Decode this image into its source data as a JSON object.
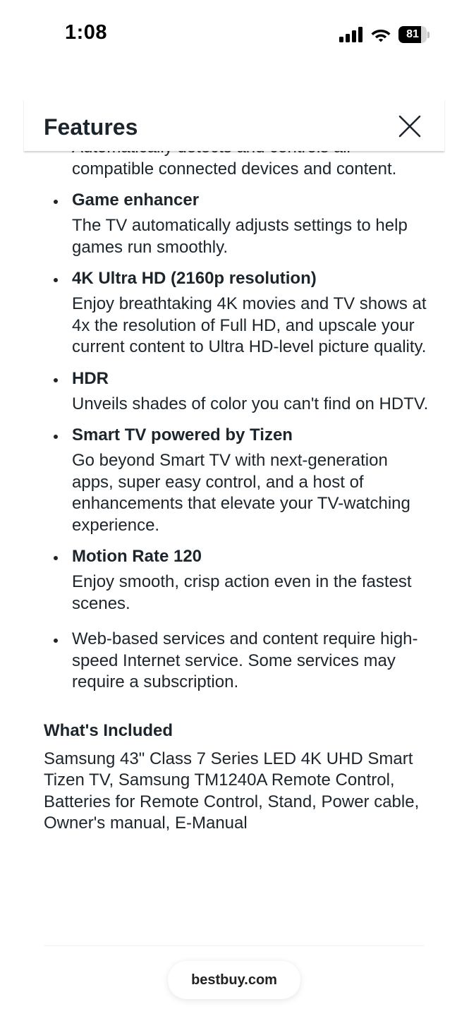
{
  "status_bar": {
    "time": "1:08",
    "battery_level": 81,
    "battery_text": "81",
    "icons": [
      "cellular-signal-icon",
      "wifi-icon",
      "battery-icon"
    ]
  },
  "modal": {
    "title": "Features",
    "close_icon": "close-icon"
  },
  "features": {
    "partial_description": "Automatically detects and controls all compatible connected devices and content.",
    "items": [
      {
        "title": "Game enhancer",
        "description": "The TV automatically adjusts settings to help games run smoothly."
      },
      {
        "title": "4K Ultra HD (2160p resolution)",
        "description": "Enjoy breathtaking 4K movies and TV shows at 4x the resolution of Full HD, and upscale your current content to Ultra HD-level picture quality."
      },
      {
        "title": "HDR",
        "description": "Unveils shades of color you can't find on HDTV."
      },
      {
        "title": "Smart TV powered by Tizen",
        "description": "Go beyond Smart TV with next-generation apps, super easy control, and a host of enhancements that elevate your TV-watching experience."
      },
      {
        "title": "Motion Rate 120",
        "description": "Enjoy smooth, crisp action even in the fastest scenes."
      }
    ],
    "note": "Web-based services and content require high-speed Internet service. Some services may require a subscription."
  },
  "whats_included": {
    "title": "What's Included",
    "text": "Samsung 43\" Class 7 Series LED 4K UHD Smart Tizen TV, Samsung TM1240A Remote Control, Batteries for Remote Control, Stand, Power cable, Owner's manual, E-Manual"
  },
  "browser": {
    "url": "bestbuy.com"
  }
}
